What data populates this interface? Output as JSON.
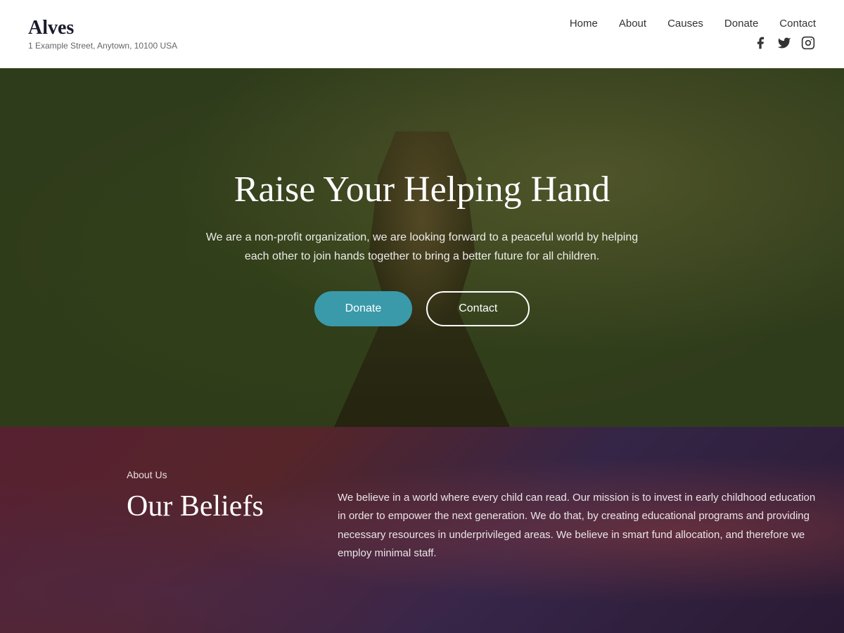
{
  "header": {
    "brand_name": "Alves",
    "brand_address": "1 Example Street, Anytown, 10100 USA",
    "nav": {
      "home": "Home",
      "about": "About",
      "causes": "Causes",
      "donate": "Donate",
      "contact": "Contact"
    },
    "social": {
      "facebook": "f",
      "twitter": "t",
      "instagram": "ig"
    }
  },
  "hero": {
    "title": "Raise Your Helping Hand",
    "subtitle": "We are a non-profit organization, we are looking forward to a peaceful world by helping each other to join hands together to bring a better future for all children.",
    "btn_donate": "Donate",
    "btn_contact": "Contact"
  },
  "about": {
    "label": "About Us",
    "title": "Our Beliefs",
    "text": "We believe in a world where every child can read. Our mission is to invest in early childhood education in order to empower the next generation. We do that, by creating educational programs and providing necessary resources in underprivileged areas. We believe in smart fund allocation, and therefore we employ minimal staff."
  }
}
